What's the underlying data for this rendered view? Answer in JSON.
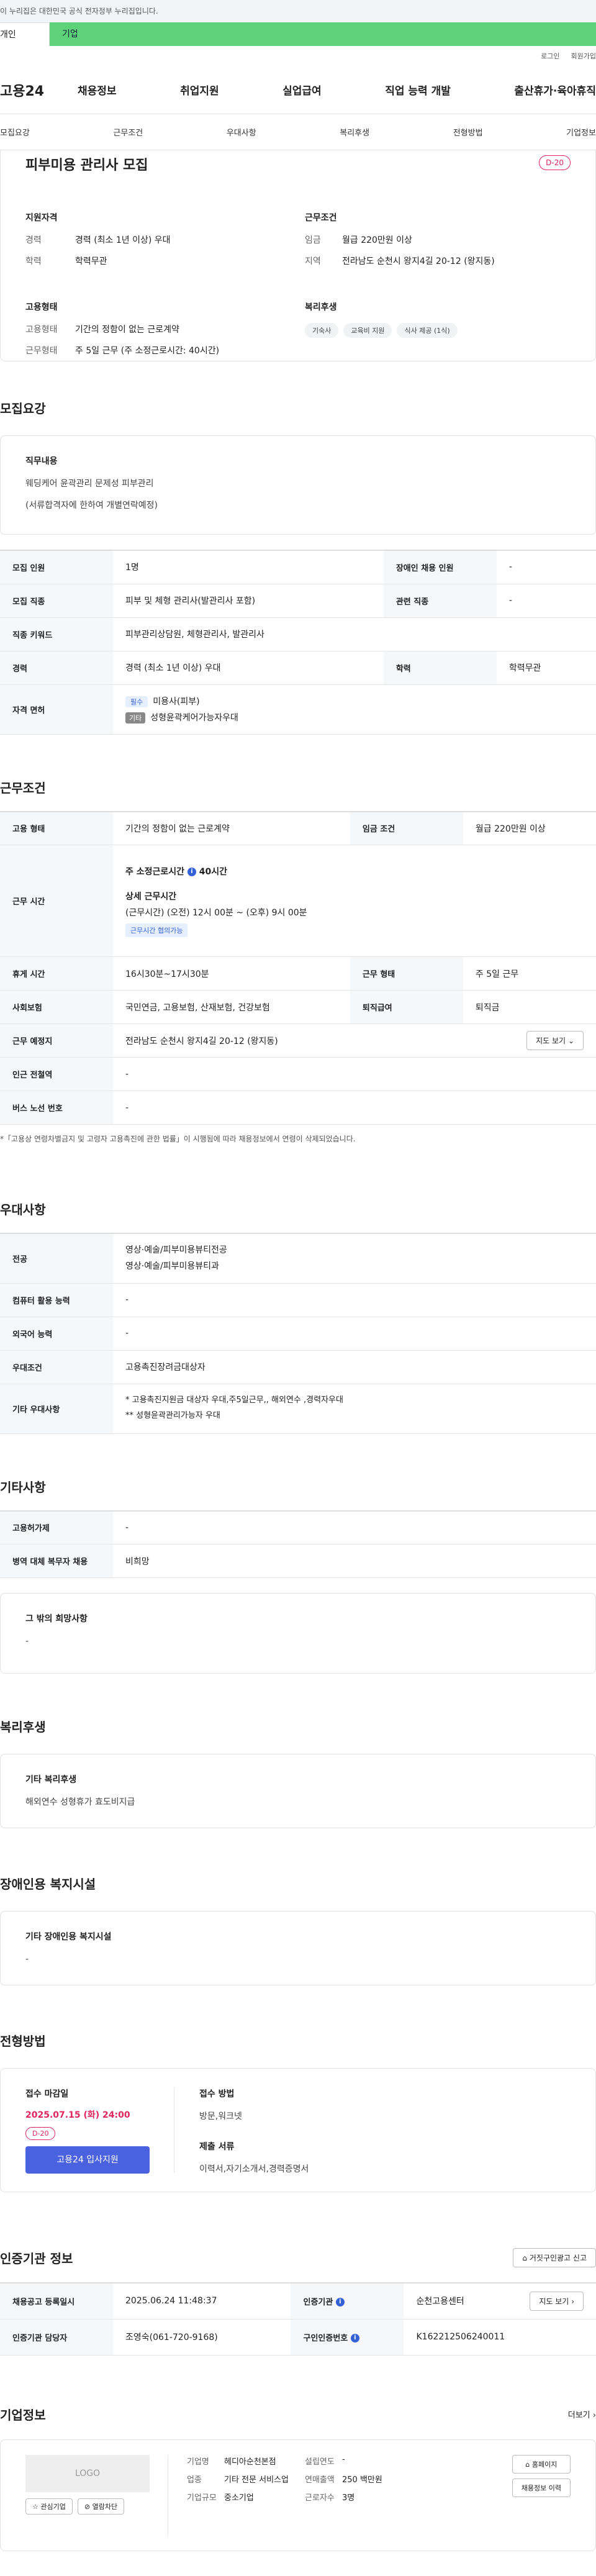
{
  "gov_banner": "이 누리집은 대한민국 공식 전자정부 누리집입니다.",
  "tabs": {
    "person": "개인",
    "company": "기업"
  },
  "util": {
    "login": "로그인",
    "signup": "회원가입"
  },
  "nav": {
    "logo": "고용24",
    "items": [
      "채용정보",
      "취업지원",
      "실업급여",
      "직업 능력 개발",
      "출산휴가·육아휴직"
    ]
  },
  "anchors": [
    "모집요강",
    "근무조건",
    "우대사항",
    "복리후생",
    "전형방법",
    "기업정보"
  ],
  "header": {
    "title": "피부미용 관리사 모집",
    "dday": "D-20",
    "qual_title": "지원자격",
    "qual": [
      {
        "k": "경력",
        "v": "경력 (최소 1년 이상) 우대"
      },
      {
        "k": "학력",
        "v": "학력무관"
      }
    ],
    "cond_title": "근무조건",
    "cond": [
      {
        "k": "임금",
        "v": "월급 220만원 이상"
      },
      {
        "k": "지역",
        "v": "전라남도 순천시 왕지4길 20-12 (왕지동)"
      }
    ],
    "emp_title": "고용형태",
    "emp": [
      {
        "k": "고용형태",
        "v": "기간의 정함이 없는 근로계약"
      },
      {
        "k": "근무형태",
        "v": "주 5일 근무 (주 소정근로시간: 40시간)"
      }
    ],
    "welfare_title": "복리후생",
    "welfare_chips": [
      "기숙사",
      "교육비 지원",
      "식사 제공 (1식)"
    ]
  },
  "recruit": {
    "title": "모집요강",
    "duty_title": "직무내용",
    "duty_lines": [
      "웨딩케어 윤곽관리 문제성 피부관리",
      "(서류합격자에 한하여 개별연락예정)"
    ],
    "rows": {
      "count_k": "모집 인원",
      "count_v": "1명",
      "disabled_k": "장애인 채용 인원",
      "disabled_v": "-",
      "job_k": "모집 직종",
      "job_v": "피부 및 체형 관리사(발관리사 포함)",
      "related_k": "관련 직종",
      "related_v": "-",
      "keyword_k": "직종 키워드",
      "keyword_v": "피부관리상담원, 체형관리사, 발관리사",
      "career_k": "경력",
      "career_v": "경력 (최소 1년 이상) 우대",
      "edu_k": "학력",
      "edu_v": "학력무관",
      "license_k": "자격 면허",
      "license_1_badge": "필수",
      "license_1": "미용사(피부)",
      "license_2_badge": "기타",
      "license_2": "성형윤곽케어가능자우대"
    }
  },
  "work": {
    "title": "근무조건",
    "type_k": "고용 형태",
    "type_v": "기간의 정함이 없는 근로계약",
    "wage_k": "임금 조건",
    "wage_v": "월급 220만원 이상",
    "hours_k": "근무 시간",
    "hours_week": "주 소정근로시간",
    "hours_week_v": "40시간",
    "hours_detail_t": "상세 근무시간",
    "hours_detail_v": "(근무시간) (오전) 12시 00분 ~ (오후) 9시 00분",
    "hours_badge": "근무시간 협의가능",
    "rest_k": "휴게 시간",
    "rest_v": "16시30분~17시30분",
    "form_k": "근무 형태",
    "form_v": "주 5일 근무",
    "ins_k": "사회보험",
    "ins_v": "국민연금, 고용보험, 산재보험, 건강보험",
    "sev_k": "퇴직급여",
    "sev_v": "퇴직금",
    "place_k": "근무 예정지",
    "place_v": "전라남도 순천시 왕지4길 20-12 (왕지동)",
    "map_btn": "지도 보기",
    "subway_k": "인근 전철역",
    "subway_v": "-",
    "bus_k": "버스 노선 번호",
    "bus_v": "-",
    "note": "*「고용상 연령차별금지 및 고령자 고용촉진에 관한 법률」이 시행됨에 따라 채용정보에서 연령이 삭제되었습니다."
  },
  "pref": {
    "title": "우대사항",
    "major_k": "전공",
    "major_v1": "영상·예술/피부미용뷰티전공",
    "major_v2": "영상·예술/피부미용뷰티과",
    "pc_k": "컴퓨터 활용 능력",
    "pc_v": "-",
    "lang_k": "외국어 능력",
    "lang_v": "-",
    "cond_k": "우대조건",
    "cond_v": "고용촉진장려금대상자",
    "etc_k": "기타 우대사항",
    "etc_v1": "* 고용촉진지원금 대상자 우대,주5일근무,,  해외연수 ,경력자우대",
    "etc_v2": "** 성형윤곽관리가능자 우대"
  },
  "other": {
    "title": "기타사항",
    "permit_k": "고용허가제",
    "permit_v": "-",
    "military_k": "병역 대체 복무자 채용",
    "military_v": "비희망",
    "wish_title": "그 밖의 희망사항",
    "wish_v": "-"
  },
  "welfare": {
    "title": "복리후생",
    "box_title": "기타 복리후생",
    "box_v": "해외연수 성형휴가 효도비지급"
  },
  "facility": {
    "title": "장애인용 복지시설",
    "box_title": "기타 장애인용 복지시설",
    "box_v": "-"
  },
  "process": {
    "title": "전형방법",
    "deadline_t": "접수 마감일",
    "deadline_v": "2025.07.15 (화) 24:00",
    "dday": "D-20",
    "apply_btn": "고용24 입사지원",
    "method_t": "접수 방법",
    "method_v": "방문,워크넷",
    "docs_t": "제출 서류",
    "docs_v": "이력서,자기소개서,경력증명서"
  },
  "cert": {
    "title": "인증기관 정보",
    "report_btn": "거짓구인광고 신고",
    "reg_k": "채용공고 등록일시",
    "reg_v": "2025.06.24 11:48:37",
    "org_k": "인증기관",
    "org_v": "순천고용센터",
    "map_btn": "지도 보기",
    "mgr_k": "인증기관 담당자",
    "mgr_v": "조영숙(061-720-9168)",
    "no_k": "구인인증번호",
    "no_v": "K162212506240011"
  },
  "company": {
    "title": "기업정보",
    "more": "더보기",
    "logo": "LOGO",
    "fav_btn": "관심기업",
    "block_btn": "열람차단",
    "name_k": "기업명",
    "name_v": "헤디아순천본점",
    "ind_k": "업종",
    "ind_v": "기타 전문 서비스업",
    "size_k": "기업규모",
    "size_v": "중소기업",
    "year_k": "설립연도",
    "year_v": "-",
    "sales_k": "연매출액",
    "sales_v": "250 백만원",
    "emp_k": "근로자수",
    "emp_v": "3명",
    "home_btn": "홈페이지",
    "hist_btn": "채용정보 이력"
  }
}
